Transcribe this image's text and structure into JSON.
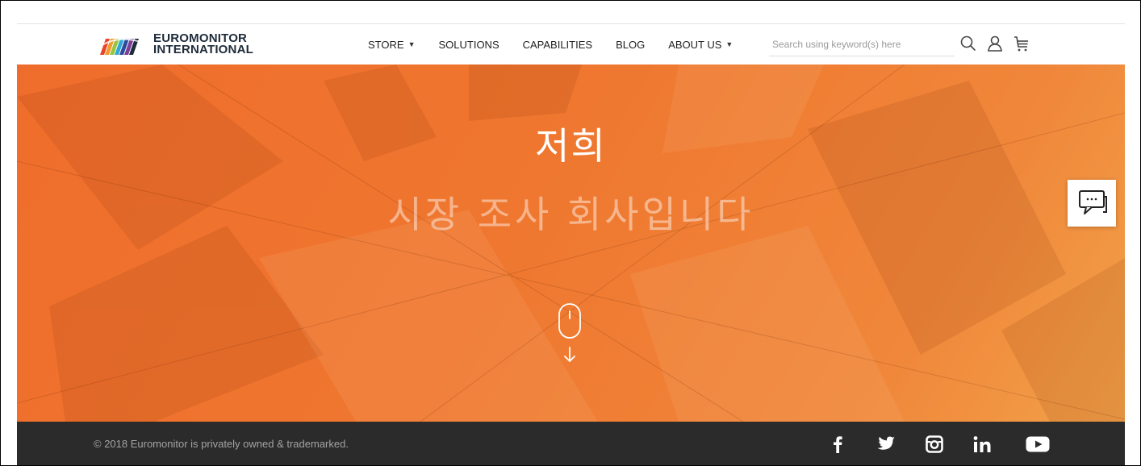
{
  "brand": {
    "name_line1": "EUROMONITOR",
    "name_line2": "INTERNATIONAL",
    "logo_icon": "rainbow-stripes-logo"
  },
  "nav": {
    "items": [
      {
        "label": "STORE",
        "has_dropdown": true
      },
      {
        "label": "SOLUTIONS",
        "has_dropdown": false
      },
      {
        "label": "CAPABILITIES",
        "has_dropdown": false
      },
      {
        "label": "BLOG",
        "has_dropdown": false
      },
      {
        "label": "ABOUT US",
        "has_dropdown": true
      }
    ],
    "caret": "▼"
  },
  "search": {
    "placeholder": "Search using keyword(s) here",
    "value": ""
  },
  "header_icons": [
    "search-icon",
    "user-icon",
    "cart-icon"
  ],
  "hero": {
    "title": "저희",
    "subtitle": "시장 조사 회사입니다",
    "scroll_icon": "mouse-scroll-down-icon"
  },
  "chat": {
    "icon": "chat-bubble-icon"
  },
  "footer": {
    "copyright": "© 2018 Euromonitor is privately owned & trademarked.",
    "social": [
      {
        "name": "facebook",
        "glyph": "f"
      },
      {
        "name": "twitter",
        "glyph": ""
      },
      {
        "name": "instagram",
        "glyph": ""
      },
      {
        "name": "linkedin",
        "glyph": "in"
      },
      {
        "name": "youtube",
        "glyph": ""
      }
    ]
  },
  "colors": {
    "hero_orange": "#ef6d2c",
    "footer_bg": "#2b2b2b",
    "nav_text": "#222222",
    "brand_navy": "#1e2b3a"
  }
}
